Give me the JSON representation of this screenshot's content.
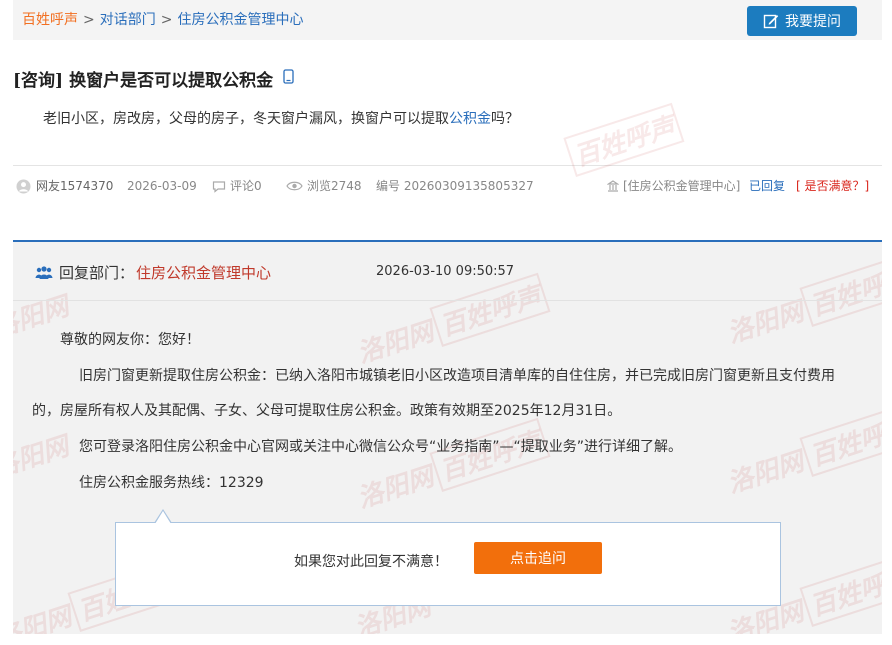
{
  "breadcrumb": {
    "home": "百姓呼声",
    "separator": ">",
    "level1": "对话部门",
    "level2": "住房公积金管理中心"
  },
  "ask_button": {
    "label": "我要提问",
    "icon": "edit-icon"
  },
  "question": {
    "tag": "[咨询]",
    "title": "换窗户是否可以提取公积金",
    "body_before": "老旧小区，房改房，父母的房子，冬天窗户漏风，换窗户可以提取",
    "body_keyword": "公积金",
    "body_after": "吗？"
  },
  "meta": {
    "user": "网友1574370",
    "date": "2026-03-09",
    "comments": "评论0",
    "views": "浏览2748",
    "serial": "编号 20260309135805327",
    "dept": "[住房公积金管理中心]",
    "status": "已回复",
    "satisfied": "[ 是否满意？]"
  },
  "reply": {
    "dept_label": "回复部门：",
    "dept_name": "住房公积金管理中心",
    "time": "2026-03-10 09:50:57",
    "greeting": "尊敬的网友你：您好！",
    "para1_line1": "旧房门窗更新提取住房公积金：已纳入洛阳市城镇老旧小区改造项目清单库的自住住房，并已完成旧房门窗更新且支付费用",
    "para1_line2": "的，房屋所有权人及其配偶、子女、父母可提取住房公积金。政策有效期至2025年12月31日。",
    "para2": "您可登录洛阳住房公积金中心官网或关注中心微信公众号“业务指南”—“提取业务”进行详细了解。",
    "hotline": "住房公积金服务热线：12329"
  },
  "feedback": {
    "prompt": "如果您对此回复不满意！",
    "button": "点击追问"
  },
  "watermark": {
    "script": "洛阳网",
    "box": "百姓呼声"
  },
  "colors": {
    "accent_blue": "#1c7cbf",
    "orange": "#f26f0c",
    "red": "#c0392b"
  }
}
